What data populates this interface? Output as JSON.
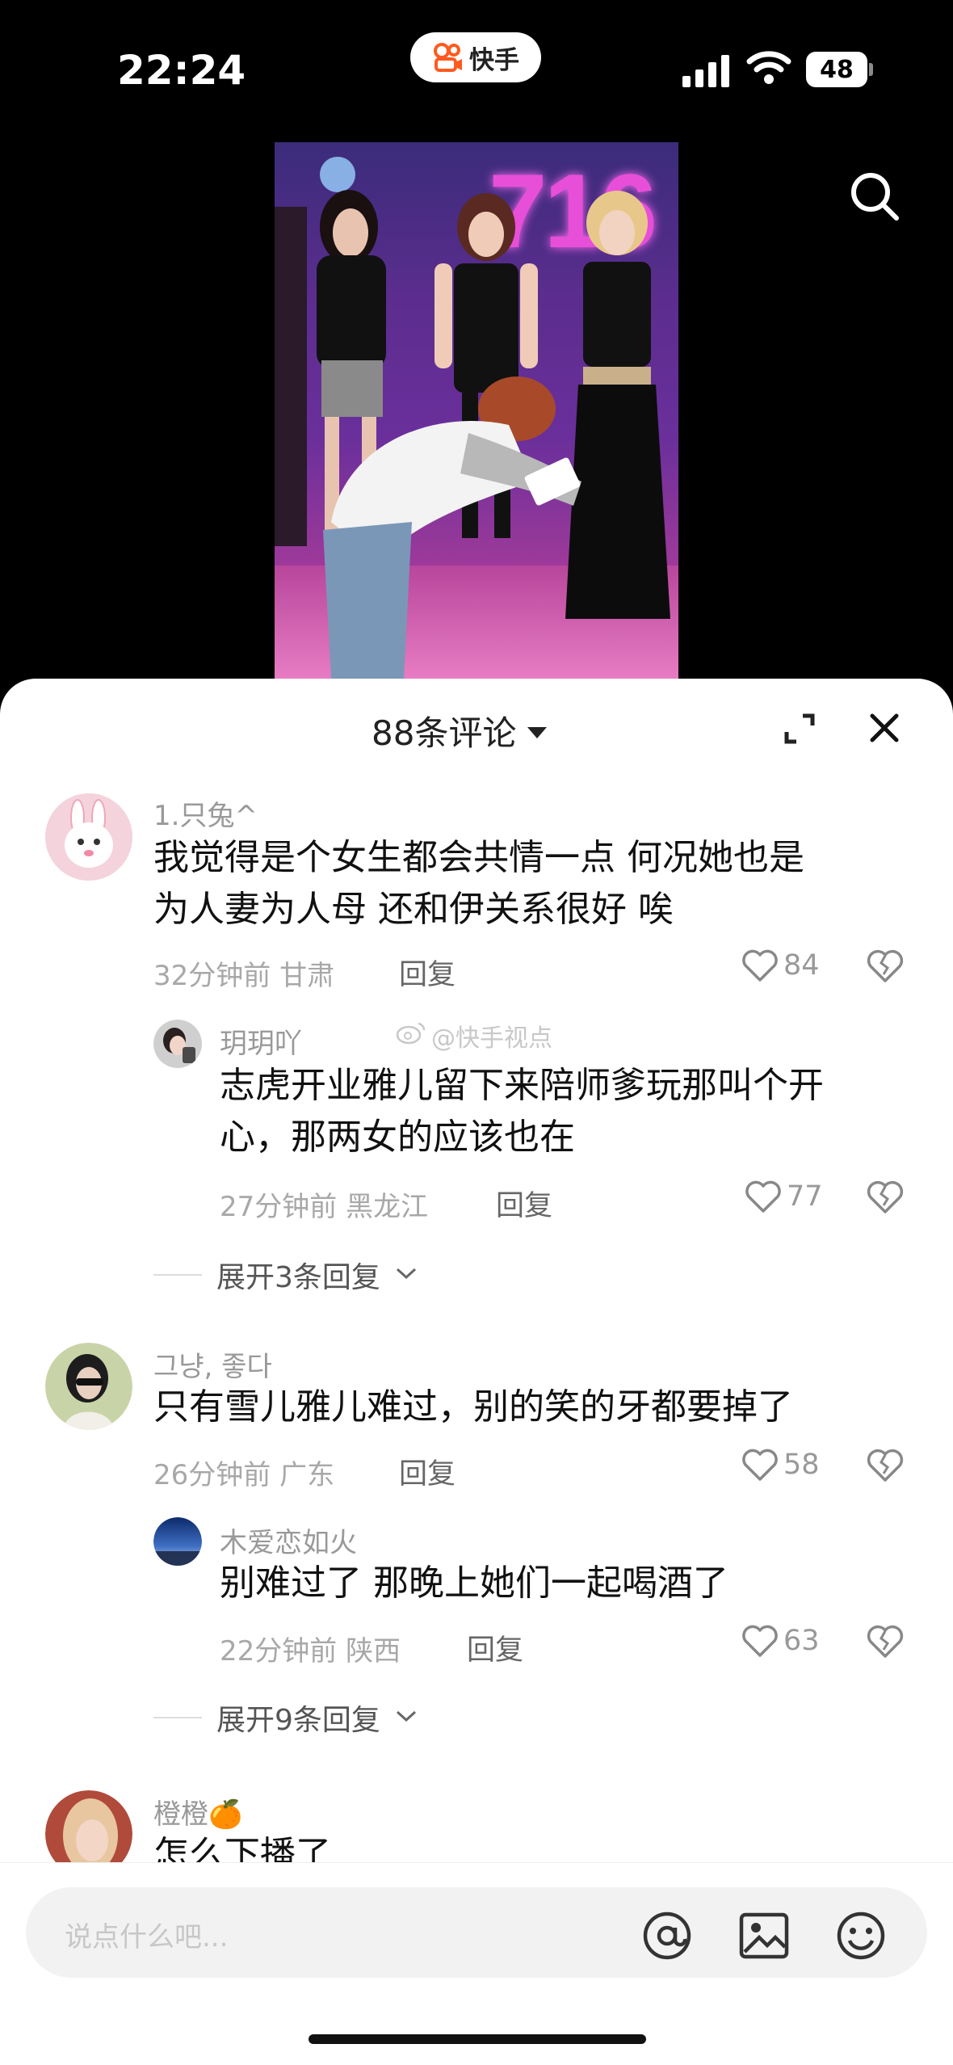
{
  "status_bar": {
    "time": "22:24",
    "app_name": "快手",
    "battery": "48"
  },
  "comments_panel": {
    "title": "88条评论",
    "watermark": "@快手视点",
    "comments": [
      {
        "username": "1.只兔^",
        "text_line1": "我觉得是个女生都会共情一点 何况她也是",
        "text_line2": "为人妻为人母 还和伊关系很好 唉",
        "time": "32分钟前",
        "location": "甘肃",
        "reply_label": "回复",
        "likes": "84",
        "replies": [
          {
            "username": "玥玥吖",
            "text_line1": "志虎开业雅儿留下来陪师爹玩那叫个开",
            "text_line2": "心，那两女的应该也在",
            "time": "27分钟前",
            "location": "黑龙江",
            "reply_label": "回复",
            "likes": "77"
          }
        ],
        "expand_label": "展开3条回复"
      },
      {
        "username": "그냥, 좋다",
        "text_line1": "只有雪儿雅儿难过，别的笑的牙都要掉了",
        "time": "26分钟前",
        "location": "广东",
        "reply_label": "回复",
        "likes": "58",
        "replies": [
          {
            "username": "木爱恋如火",
            "text_line1": "别难过了 那晚上她们一起喝酒了",
            "time": "22分钟前",
            "location": "陕西",
            "reply_label": "回复",
            "likes": "63"
          }
        ],
        "expand_label": "展开9条回复"
      },
      {
        "username": "橙橙🍊",
        "text_line1": "怎么下播了"
      }
    ]
  },
  "input": {
    "placeholder": "说点什么吧..."
  },
  "video": {
    "overlay_text": "716"
  }
}
